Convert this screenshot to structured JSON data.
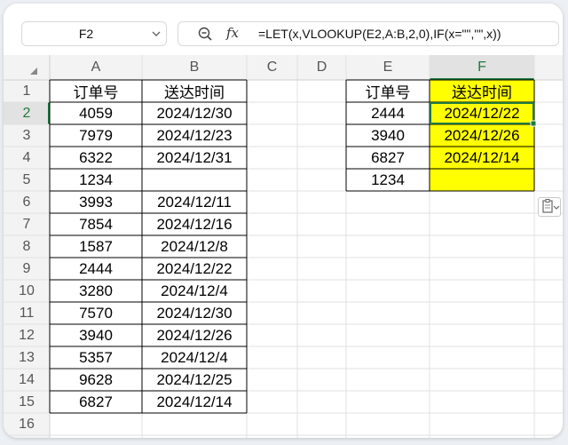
{
  "formula_bar": {
    "name_box": "F2",
    "fx_label": "fx",
    "formula": "=LET(x,VLOOKUP(E2,A:B,2,0),IF(x=\"\",\"\",x))"
  },
  "sheet": {
    "col_headers": [
      "A",
      "B",
      "C",
      "D",
      "E",
      "F"
    ],
    "row_headers": [
      "1",
      "2",
      "3",
      "4",
      "5",
      "6",
      "7",
      "8",
      "9",
      "10",
      "11",
      "12",
      "13",
      "14",
      "15",
      "16"
    ],
    "selected_cell": "F2",
    "highlight_color": "#ffff00",
    "selection_color": "#1f7a3e",
    "col_a": [
      "订单号",
      "4059",
      "7979",
      "6322",
      "1234",
      "3993",
      "7854",
      "1587",
      "2444",
      "3280",
      "7570",
      "3940",
      "5357",
      "9628",
      "6827"
    ],
    "col_b": [
      "送达时间",
      "2024/12/30",
      "2024/12/23",
      "2024/12/31",
      "",
      "2024/12/11",
      "2024/12/16",
      "2024/12/8",
      "2024/12/22",
      "2024/12/4",
      "2024/12/30",
      "2024/12/26",
      "2024/12/4",
      "2024/12/25",
      "2024/12/14"
    ],
    "col_e": [
      "订单号",
      "2444",
      "3940",
      "6827",
      "1234"
    ],
    "col_f": [
      "送达时间",
      "2024/12/22",
      "2024/12/26",
      "2024/12/14",
      ""
    ]
  }
}
